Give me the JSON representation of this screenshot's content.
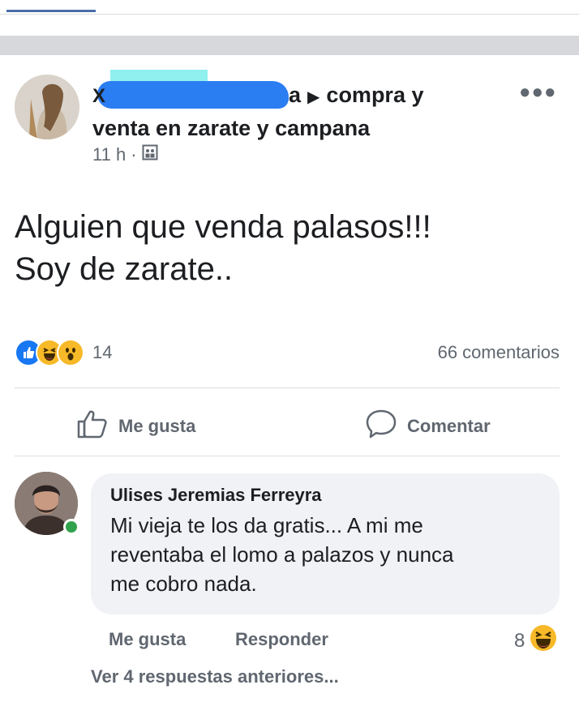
{
  "post": {
    "author_prefix": "X",
    "author_tail": "a",
    "group_line1": "compra y",
    "group_line2": "venta en zarate y campana",
    "time": "11 h",
    "meta_sep": "·",
    "text_line1": "Alguien que venda palasos!!!",
    "text_line2": "Soy de zarate..",
    "reaction_count": "14",
    "comments_count": "66 comentarios",
    "like_label": "Me gusta",
    "comment_label": "Comentar"
  },
  "comment": {
    "author": "Ulises Jeremias Ferreyra",
    "text_line1": "Mi vieja te los da gratis... A mi me",
    "text_line2": "reventaba  el lomo a palazos y nunca",
    "text_line3": "me cobro nada.",
    "like_label": "Me gusta",
    "reply_label": "Responder",
    "reaction_count": "8",
    "view_replies": "Ver 4 respuestas anteriores..."
  },
  "icons": {
    "more": "more-options-icon",
    "audience": "group-audience-icon",
    "reactions": [
      "like-reaction-icon",
      "haha-reaction-icon",
      "wow-reaction-icon"
    ],
    "like_button": "thumbs-up-icon",
    "comment_button": "speech-bubble-icon"
  },
  "colors": {
    "facebook_blue": "#1877f2",
    "reaction_yellow": "#f7b928",
    "secondary_text": "#606770",
    "online_green": "#31a24c",
    "bubble_bg": "#f0f2f5"
  }
}
